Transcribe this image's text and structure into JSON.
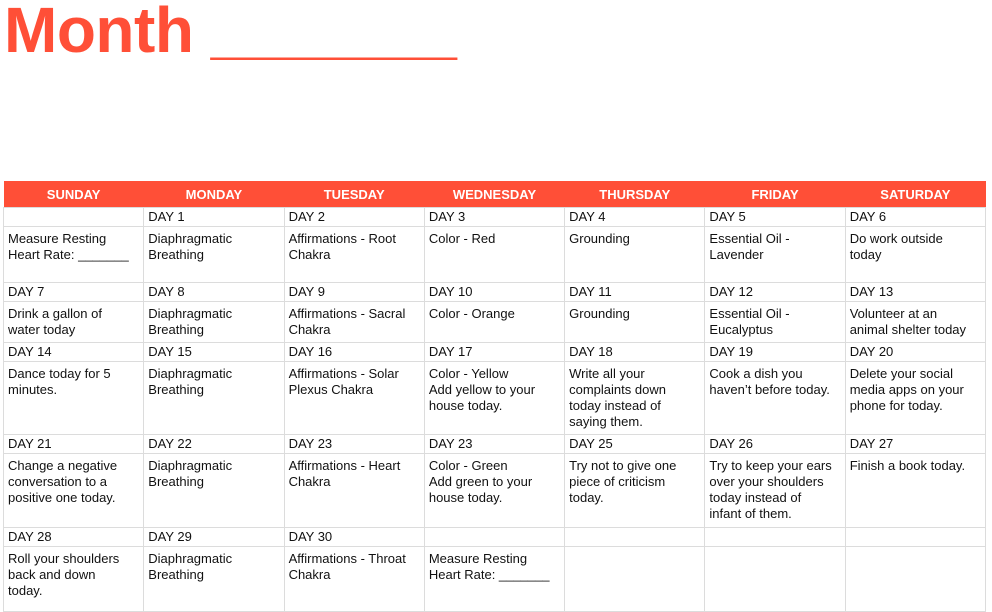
{
  "title": "Month _______",
  "colors": {
    "accent": "#FF4F37",
    "grid": "#DCDCDC",
    "text": "#111111"
  },
  "weekdays": [
    "SUNDAY",
    "MONDAY",
    "TUESDAY",
    "WEDNESDAY",
    "THURSDAY",
    "FRIDAY",
    "SATURDAY"
  ],
  "weeks": [
    {
      "days": [
        "",
        "DAY 1",
        "DAY 2",
        "DAY 3",
        "DAY 4",
        "DAY 5",
        "DAY 6"
      ],
      "tasks": [
        "Measure Resting\nHeart Rate: _______",
        "Diaphragmatic\nBreathing",
        "Affirmations - Root\nChakra",
        "Color - Red",
        "Grounding",
        "Essential Oil -\nLavender",
        "Do work outside\ntoday"
      ]
    },
    {
      "days": [
        "DAY 7",
        "DAY 8",
        "DAY 9",
        "DAY 10",
        "DAY 11",
        "DAY 12",
        "DAY 13"
      ],
      "tasks": [
        "Drink a gallon of\nwater today",
        "Diaphragmatic\nBreathing",
        "Affirmations - Sacral\nChakra",
        "Color - Orange",
        "Grounding",
        "Essential Oil -\nEucalyptus",
        "Volunteer at an\nanimal shelter today"
      ]
    },
    {
      "days": [
        "DAY 14",
        "DAY 15",
        "DAY 16",
        "DAY 17",
        "DAY 18",
        "DAY 19",
        "DAY 20"
      ],
      "tasks": [
        "Dance today for 5\nminutes.",
        "Diaphragmatic\nBreathing",
        "Affirmations - Solar\nPlexus Chakra",
        "Color - Yellow\nAdd yellow to your\nhouse today.",
        "Write all your\ncomplaints down\ntoday instead of\nsaying them.",
        "Cook a dish you\nhaven’t before today.",
        "Delete your social\nmedia apps on your\nphone for today."
      ]
    },
    {
      "days": [
        "DAY 21",
        "DAY 22",
        "DAY 23",
        "DAY 23",
        "DAY 25",
        "DAY 26",
        "DAY 27"
      ],
      "tasks": [
        "Change a negative\nconversation to a\npositive one today.",
        "Diaphragmatic\nBreathing",
        "Affirmations - Heart\nChakra",
        "Color - Green\nAdd green to your\nhouse today.",
        "Try not to give one\npiece of criticism\ntoday.",
        "Try to keep your ears\nover your shoulders\ntoday instead of\ninfant of them.",
        "Finish a book today."
      ]
    },
    {
      "days": [
        "DAY 28",
        "DAY 29",
        "DAY 30",
        "",
        "",
        "",
        ""
      ],
      "tasks": [
        "Roll your shoulders\nback and down\ntoday.",
        "Diaphragmatic\nBreathing",
        "Affirmations - Throat\nChakra",
        "Measure Resting\nHeart Rate: _______",
        "",
        "",
        ""
      ]
    }
  ]
}
